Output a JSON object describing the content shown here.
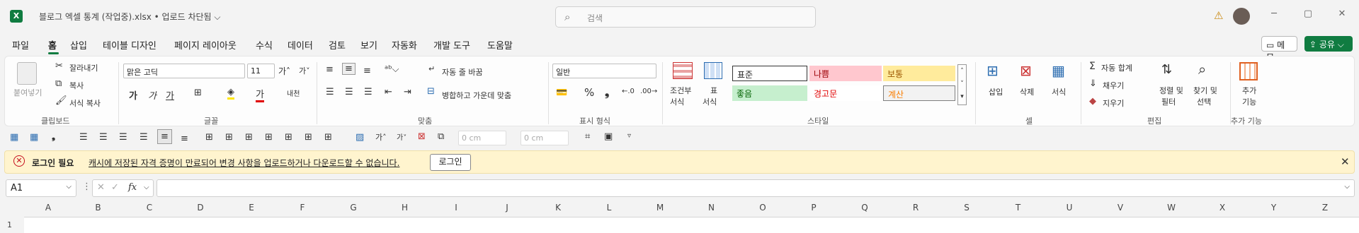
{
  "title_bar": {
    "app_icon": "excel-icon",
    "app_letter": "X",
    "document_title": "블로그 엑셀 통계 (작업중).xlsx • 업로드 차단됨 ⌵",
    "search_placeholder": "검색",
    "window_controls": [
      "─",
      "▢",
      "✕"
    ]
  },
  "menu": {
    "items": [
      "파일",
      "홈",
      "삽입",
      "테이블 디자인",
      "페이지 레이아웃",
      "수식",
      "데이터",
      "검토",
      "보기",
      "자동화",
      "개발 도구",
      "도움말"
    ],
    "active": "홈",
    "memo_label": "메모",
    "share_label": "공유"
  },
  "ribbon": {
    "clipboard": {
      "paste": "붙여넣기",
      "cut": "잘라내기",
      "copy": "복사",
      "format_painter": "서식 복사",
      "group": "클립보드"
    },
    "font": {
      "name": "맑은 고딕",
      "size": "11",
      "group": "글꼴"
    },
    "alignment": {
      "wrap_text": "자동 줄 바꿈",
      "merge_center": "병합하고 가운데 맞춤",
      "group": "맞춤"
    },
    "number": {
      "format": "일반",
      "group": "표시 형식"
    },
    "styles": {
      "conditional": "조건부",
      "conditional_2": "서식",
      "table": "표",
      "table_2": "서식",
      "cells": [
        "표준",
        "나쁨",
        "보통",
        "좋음",
        "경고문",
        "계산"
      ],
      "group": "스타일"
    },
    "cells": {
      "insert": "삽입",
      "delete": "삭제",
      "format": "서식",
      "group": "셀"
    },
    "editing": {
      "autosum": "자동 합계",
      "fill": "채우기",
      "clear": "지우기",
      "sort": "정렬 및",
      "sort_2": "필터",
      "find": "찾기 및",
      "find_2": "선택",
      "group": "편집"
    },
    "addins": {
      "label": "추가",
      "label_2": "기능",
      "group": "추가 기능"
    }
  },
  "qat": {
    "width_value": "0 cm",
    "height_value": "0 cm"
  },
  "message_bar": {
    "title": "로그인 필요",
    "text": "캐시에 저장된 자격 증명이 만료되어 변경 사항을 업로드하거나 다운로드할 수 없습니다.",
    "button": "로그인"
  },
  "formula_bar": {
    "name_box": "A1",
    "fx": "fx"
  },
  "sheet": {
    "columns": [
      "A",
      "B",
      "C",
      "D",
      "E",
      "F",
      "G",
      "H",
      "I",
      "J",
      "K",
      "L",
      "M",
      "N",
      "O",
      "P",
      "Q",
      "R",
      "S",
      "T",
      "U",
      "V",
      "W",
      "X",
      "Y",
      "Z"
    ],
    "first_row": "1"
  }
}
